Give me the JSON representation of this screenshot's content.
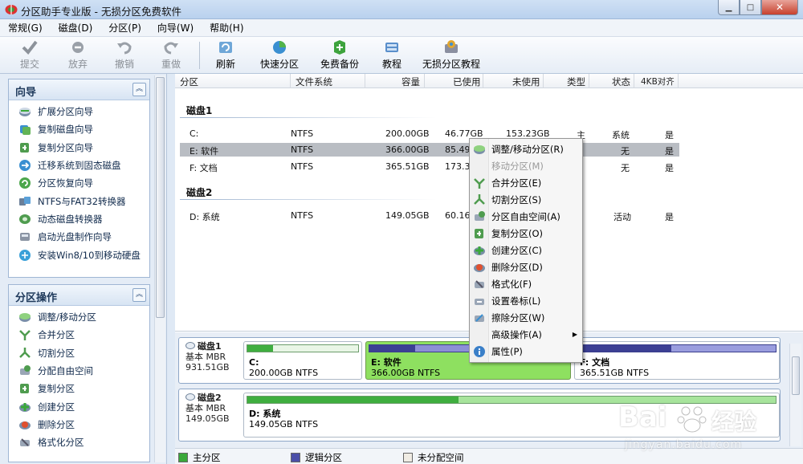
{
  "window": {
    "title": "分区助手专业版 - 无损分区免费软件"
  },
  "menu": [
    "常规(G)",
    "磁盘(D)",
    "分区(P)",
    "向导(W)",
    "帮助(H)"
  ],
  "toolbar": [
    {
      "label": "提交",
      "icon": "check-icon",
      "enabled": false
    },
    {
      "label": "放弃",
      "icon": "discard-icon",
      "enabled": false
    },
    {
      "label": "撤销",
      "icon": "undo-icon",
      "enabled": false
    },
    {
      "label": "重做",
      "icon": "redo-icon",
      "enabled": false
    },
    {
      "label": "刷新",
      "icon": "refresh-icon",
      "enabled": true
    },
    {
      "label": "快速分区",
      "icon": "quick-partition-icon",
      "enabled": true
    },
    {
      "label": "免费备份",
      "icon": "backup-icon",
      "enabled": true
    },
    {
      "label": "教程",
      "icon": "tutorial-icon",
      "enabled": true
    },
    {
      "label": "无损分区教程",
      "icon": "lossless-tutorial-icon",
      "enabled": true
    }
  ],
  "wizard_panel": {
    "title": "向导",
    "items": [
      "扩展分区向导",
      "复制磁盘向导",
      "复制分区向导",
      "迁移系统到固态磁盘",
      "分区恢复向导",
      "NTFS与FAT32转换器",
      "动态磁盘转换器",
      "启动光盘制作向导",
      "安装Win8/10到移动硬盘"
    ]
  },
  "ops_panel": {
    "title": "分区操作",
    "items": [
      "调整/移动分区",
      "合并分区",
      "切割分区",
      "分配自由空间",
      "复制分区",
      "创建分区",
      "删除分区",
      "格式化分区"
    ]
  },
  "columns": [
    "分区",
    "文件系统",
    "容量",
    "已使用",
    "未使用",
    "类型",
    "状态",
    "4KB对齐"
  ],
  "disks": [
    {
      "name": "磁盘1",
      "rows": [
        {
          "part": "C:",
          "fs": "NTFS",
          "cap": "200.00GB",
          "used": "46.77GB",
          "free": "153.23GB",
          "type": "主",
          "status": "系统",
          "align": "是"
        },
        {
          "part": "E: 软件",
          "fs": "NTFS",
          "cap": "366.00GB",
          "used": "85.49",
          "free": "",
          "type": "",
          "status": "无",
          "align": "是"
        },
        {
          "part": "F: 文档",
          "fs": "NTFS",
          "cap": "365.51GB",
          "used": "173.32",
          "free": "",
          "type": "",
          "status": "无",
          "align": "是"
        }
      ]
    },
    {
      "name": "磁盘2",
      "rows": [
        {
          "part": "D: 系统",
          "fs": "NTFS",
          "cap": "149.05GB",
          "used": "60.16",
          "free": "",
          "type": "",
          "status": "活动",
          "align": "是"
        }
      ]
    }
  ],
  "disk_map": [
    {
      "name": "磁盘1",
      "kind": "基本 MBR",
      "size": "931.51GB",
      "parts": [
        {
          "name": "C:",
          "detail": "200.00GB NTFS",
          "used_frac": 0.23
        },
        {
          "name": "E: 软件",
          "detail": "366.00GB NTFS",
          "used_frac": 0.23
        },
        {
          "name": "F: 文档",
          "detail": "365.51GB NTFS",
          "used_frac": 0.47
        }
      ]
    },
    {
      "name": "磁盘2",
      "kind": "基本 MBR",
      "size": "149.05GB",
      "parts": [
        {
          "name": "D: 系统",
          "detail": "149.05GB NTFS",
          "used_frac": 0.4
        }
      ]
    }
  ],
  "context_menu": [
    {
      "label": "调整/移动分区(R)",
      "icon": "resize-icon",
      "enabled": true
    },
    {
      "label": "移动分区(M)",
      "icon": "",
      "enabled": false
    },
    {
      "label": "合并分区(E)",
      "icon": "merge-icon",
      "enabled": true
    },
    {
      "label": "切割分区(S)",
      "icon": "split-icon",
      "enabled": true
    },
    {
      "label": "分区自由空间(A)",
      "icon": "allocate-icon",
      "enabled": true
    },
    {
      "label": "复制分区(O)",
      "icon": "copy-icon",
      "enabled": true
    },
    {
      "label": "创建分区(C)",
      "icon": "create-icon",
      "enabled": true
    },
    {
      "label": "删除分区(D)",
      "icon": "delete-icon",
      "enabled": true
    },
    {
      "label": "格式化(F)",
      "icon": "format-icon",
      "enabled": true
    },
    {
      "label": "设置卷标(L)",
      "icon": "label-icon",
      "enabled": true
    },
    {
      "label": "擦除分区(W)",
      "icon": "wipe-icon",
      "enabled": true
    },
    {
      "label": "高级操作(A)",
      "icon": "",
      "enabled": true,
      "submenu": true
    },
    {
      "label": "属性(P)",
      "icon": "info-icon",
      "enabled": true
    }
  ],
  "legend": [
    "主分区",
    "逻辑分区",
    "未分配空间"
  ],
  "watermark": {
    "text": "Bai",
    "text2": "经验",
    "url": "jingyan.baidu.com"
  },
  "colors": {
    "primary": "#3aa83a",
    "logical": "#4b4fa8",
    "unallocated": "#f0ece4",
    "selected": "#8ee060"
  }
}
